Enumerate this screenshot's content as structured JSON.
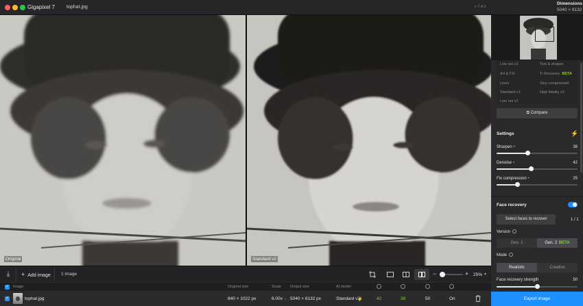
{
  "app": {
    "title": "Gigapixel 7",
    "file": "tophat.jpg",
    "version": "v 7.4.1"
  },
  "dimensions": {
    "label": "Dimensions",
    "value": "5040 × 6132"
  },
  "preview": {
    "left_label": "Original",
    "right_label": "Standard v2"
  },
  "toolbar": {
    "add_label": "Add image",
    "count_label": "1 image",
    "zoom": "25%"
  },
  "list": {
    "headers": {
      "image": "Image",
      "original_size": "Original size",
      "scale": "Scale",
      "output_size": "Output size",
      "ai_model": "AI model"
    },
    "row": {
      "name": "tophat.jpg",
      "original_size": "840 × 1022 px",
      "scale": "6.00x",
      "output_size": "5040 × 6132 px",
      "model": "Standard v2",
      "sharpen": "42",
      "denoise": "38",
      "fix_compression": "50",
      "face_recovery": "On"
    }
  },
  "models": {
    "left": [
      "Low res v2",
      "Art & CG",
      "Lines",
      "Standard v1",
      "Low res v1"
    ],
    "right": [
      "Text & shapes",
      "Recovery",
      "Very compressed",
      "High fidelity v1"
    ],
    "beta_label": "BETA"
  },
  "compare_label": "Compare",
  "settings": {
    "title": "Settings",
    "sliders": [
      {
        "label": "Sharpen",
        "value": "38",
        "level": 0.38
      },
      {
        "label": "Denoise",
        "value": "42",
        "level": 0.42
      },
      {
        "label": "Fix compression",
        "value": "25",
        "level": 0.25
      }
    ]
  },
  "face": {
    "title": "Face recovery",
    "select_label": "Select faces to recover",
    "count": "1 / 1",
    "version_label": "Version",
    "gen1": "Gen. 1",
    "gen2": "Gen. 2",
    "gen2_badge": "BETA",
    "mode_label": "Mode",
    "mode_realistic": "Realistic",
    "mode_creative": "Creative",
    "strength_label": "Face recovery strength",
    "strength_value": "50",
    "strength_level": 0.5
  },
  "export_label": "Export image",
  "colors": {
    "accent": "#1e8fff",
    "green": "#7ed321"
  }
}
